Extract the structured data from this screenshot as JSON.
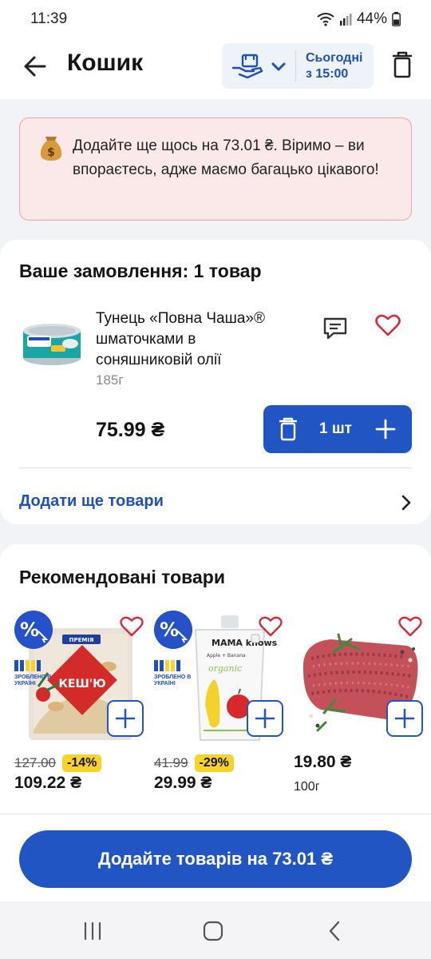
{
  "status": {
    "time": "11:39",
    "battery": "44%"
  },
  "header": {
    "title": "Кошик",
    "delivery_line1": "Сьогодні",
    "delivery_line2": "з 15:00"
  },
  "alert": {
    "text": "Додайте ще щось на 73.01 ₴. Віримо – ви впораєтесь, адже маємо багацько цікавого!"
  },
  "order": {
    "title": "Ваше замовлення: 1 товар",
    "item": {
      "name": "Тунець «Повна Чаша»® шматочками в соняшниковій олії",
      "weight": "185г",
      "price": "75.99 ₴",
      "quantity": "1 шт"
    },
    "add_more": "Додати ще товари"
  },
  "recommended": {
    "title": "Рекомендовані товари",
    "items": [
      {
        "old_price": "127.00",
        "discount": "-14%",
        "price": "109.22 ₴",
        "packaging_text": "КЕШ'Ю",
        "brand": "ПРЕМІЯ",
        "made_in": "ЗРОБЛЕНО В УКРАЇНІ"
      },
      {
        "old_price": "41.99",
        "discount": "-29%",
        "price": "29.99 ₴",
        "brand": "MAMA knows",
        "flavor": "Apple + Banana",
        "organic": "organic",
        "made_in": "ЗРОБЛЕНО В УКРАЇНІ"
      },
      {
        "price": "19.80 ₴",
        "weight": "100г"
      }
    ]
  },
  "cta": {
    "label": "Додайте товарів на 73.01 ₴"
  },
  "colors": {
    "accent": "#2255c4",
    "alert_bg": "#fbe9ea",
    "alert_border": "#f0a3a8",
    "heart": "#d8283c",
    "discount": "#f7d32a"
  }
}
